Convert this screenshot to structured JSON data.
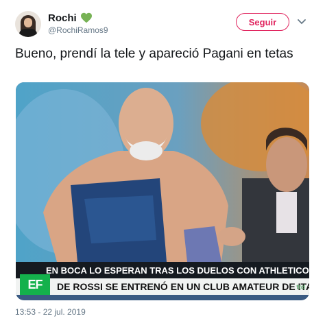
{
  "author": {
    "name": "Rochi",
    "handle": "@RochiRamos9",
    "heart_color": "#77b255"
  },
  "actions": {
    "follow_label": "Seguir",
    "accent": "#e0245e"
  },
  "tweet": {
    "text": "Bueno, prendí la tele y apareció Pagani en tetas",
    "timestamp": "13:53 - 22 jul. 2019"
  },
  "media": {
    "ticker_top": "EN BOCA LO ESPERAN TRAS LOS DUELOS CON ATHLETICO PAR",
    "ticker_bottom": "DE ROSSI SE ENTRENÓ EN UN CLUB AMATEUR DE ITALIA ANT",
    "logo_text": "EF",
    "watermark": "ttd"
  }
}
